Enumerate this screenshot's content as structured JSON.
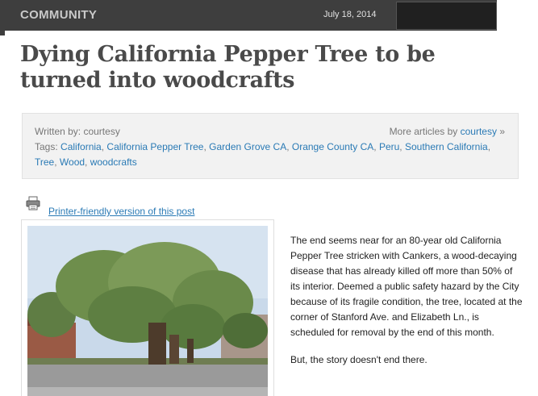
{
  "header": {
    "section": "COMMUNITY",
    "date": "July 18, 2014"
  },
  "article": {
    "title": "Dying California Pepper Tree to be turned into woodcrafts",
    "author_label": "Written by: courtesy",
    "more_prefix": "More articles by",
    "more_author": "courtesy",
    "more_suffix": "»",
    "tags_label": "Tags:",
    "tags": [
      "California",
      "California Pepper Tree",
      "Garden Grove CA",
      "Orange County CA",
      "Peru",
      "Southern California",
      "Tree",
      "Wood",
      "woodcrafts"
    ],
    "printer_link": "Printer-friendly version of this post",
    "body": [
      "The end seems near for an 80-year old California Pepper Tree stricken with Cankers, a wood-decaying disease that has already killed off more than 50% of its interior. Deemed a public safety hazard by the City because of its fragile condition, the tree, located at the corner of Stanford Ave. and Elizabeth Ln., is scheduled for removal by the end of this month.",
      "But, the story doesn't end there."
    ]
  },
  "icons": {
    "printer": "printer-icon"
  },
  "colors": {
    "topbar": "#3e3e3e",
    "link": "#2a7ab5",
    "meta_bg": "#f2f2f2"
  }
}
